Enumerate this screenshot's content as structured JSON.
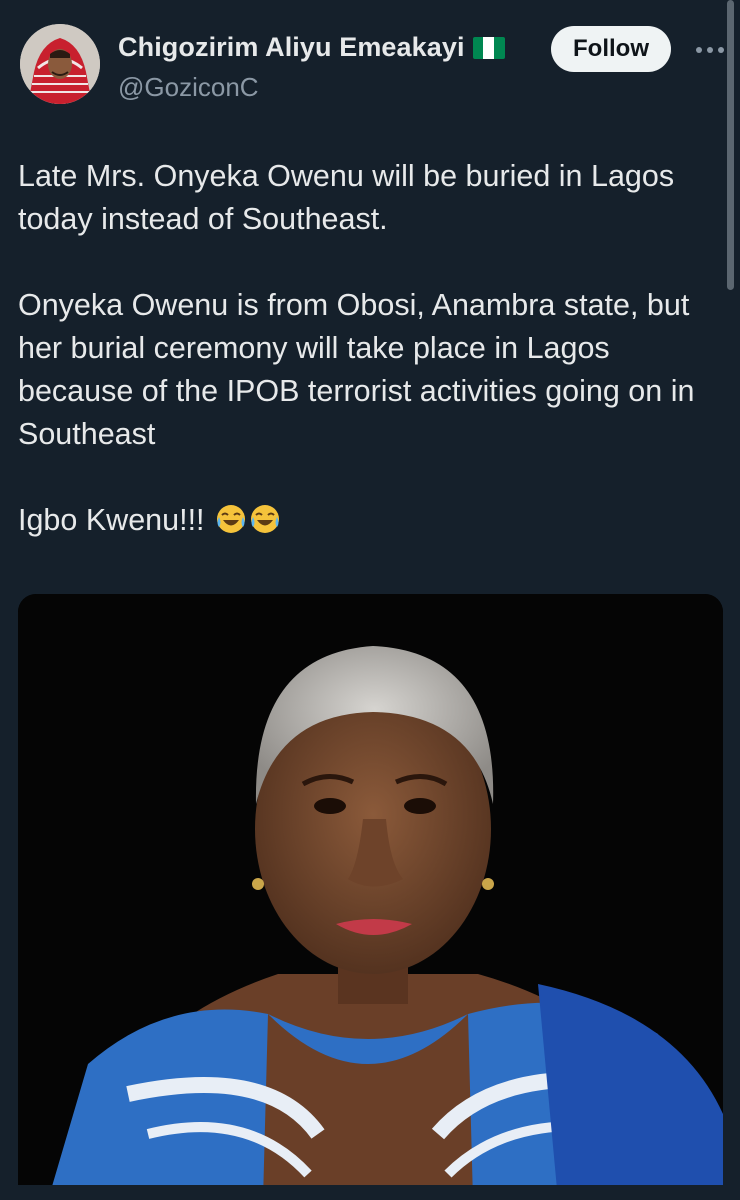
{
  "author": {
    "display_name": "Chigozirim Aliyu Emeakayi",
    "handle": "@GoziconC",
    "verified_flag_icon": "nigeria-flag-icon",
    "avatar_icon": "user-avatar"
  },
  "actions": {
    "follow_label": "Follow",
    "more_icon": "more-options-icon"
  },
  "tweet": {
    "paragraphs": [
      "Late Mrs. Onyeka Owenu will be buried in Lagos today instead of Southeast.",
      "Onyeka Owenu is from Obosi, Anambra state, but her burial ceremony will take place in Lagos because of the IPOB terrorist activities going on in Southeast",
      "Igbo Kwenu!!!"
    ],
    "trailing_emojis": "😂😂"
  },
  "media": {
    "type": "photo",
    "icon": "portrait-photo"
  },
  "colors": {
    "background": "#15202b",
    "text_primary": "#e7e9ea",
    "text_secondary": "#8b98a5",
    "follow_bg": "#eff3f4",
    "flag_green": "#008751"
  }
}
